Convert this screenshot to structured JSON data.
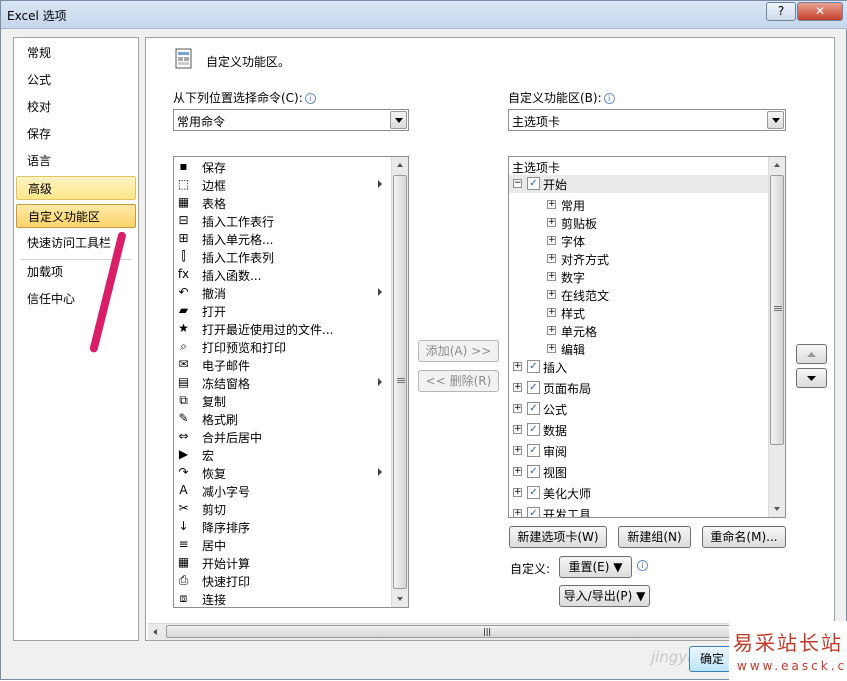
{
  "window": {
    "title": "Excel 选项",
    "help_label": "?",
    "close_label": "✕"
  },
  "sidebar": {
    "items": [
      {
        "label": "常规"
      },
      {
        "label": "公式"
      },
      {
        "label": "校对"
      },
      {
        "label": "保存"
      },
      {
        "label": "语言"
      },
      {
        "label": "高级"
      },
      {
        "label": "自定义功能区"
      },
      {
        "label": "快速访问工具栏"
      },
      {
        "label": "加载项"
      },
      {
        "label": "信任中心"
      }
    ],
    "selected": "自定义功能区"
  },
  "main": {
    "title": "自定义功能区。",
    "choose_from_label": "从下列位置选择命令(C):",
    "choose_from_value": "常用命令",
    "customize_label": "自定义功能区(B):",
    "customize_value": "主选项卡",
    "info_glyph": "i"
  },
  "commands": [
    {
      "label": "保存",
      "icon": "save-icon",
      "glyph": "▪",
      "submenu": false
    },
    {
      "label": "边框",
      "icon": "border-icon",
      "glyph": "⬚",
      "submenu": true
    },
    {
      "label": "表格",
      "icon": "table-icon",
      "glyph": "▦",
      "submenu": false
    },
    {
      "label": "插入工作表行",
      "icon": "insert-row-icon",
      "glyph": "⊟",
      "submenu": false
    },
    {
      "label": "插入单元格...",
      "icon": "insert-cell-icon",
      "glyph": "⊞",
      "submenu": false
    },
    {
      "label": "插入工作表列",
      "icon": "insert-column-icon",
      "glyph": "⫿",
      "submenu": false
    },
    {
      "label": "插入函数...",
      "icon": "function-icon",
      "glyph": "fx",
      "submenu": false
    },
    {
      "label": "撤消",
      "icon": "undo-icon",
      "glyph": "↶",
      "submenu": true
    },
    {
      "label": "打开",
      "icon": "open-folder-icon",
      "glyph": "▰",
      "submenu": false
    },
    {
      "label": "打开最近使用过的文件...",
      "icon": "recent-file-icon",
      "glyph": "★",
      "submenu": false
    },
    {
      "label": "打印预览和打印",
      "icon": "print-preview-icon",
      "glyph": "⌕",
      "submenu": false
    },
    {
      "label": "电子邮件",
      "icon": "email-icon",
      "glyph": "✉",
      "submenu": false
    },
    {
      "label": "冻结窗格",
      "icon": "freeze-panes-icon",
      "glyph": "▤",
      "submenu": true
    },
    {
      "label": "复制",
      "icon": "copy-icon",
      "glyph": "⧉",
      "submenu": false
    },
    {
      "label": "格式刷",
      "icon": "format-painter-icon",
      "glyph": "✎",
      "submenu": false
    },
    {
      "label": "合并后居中",
      "icon": "merge-center-icon",
      "glyph": "⇔",
      "submenu": false
    },
    {
      "label": "宏",
      "icon": "macro-icon",
      "glyph": "▶",
      "submenu": false
    },
    {
      "label": "恢复",
      "icon": "redo-icon",
      "glyph": "↷",
      "submenu": true
    },
    {
      "label": "减小字号",
      "icon": "decrease-font-icon",
      "glyph": "A",
      "submenu": false
    },
    {
      "label": "剪切",
      "icon": "cut-icon",
      "glyph": "✂",
      "submenu": false
    },
    {
      "label": "降序排序",
      "icon": "sort-desc-icon",
      "glyph": "↓",
      "submenu": false
    },
    {
      "label": "居中",
      "icon": "align-center-icon",
      "glyph": "≡",
      "submenu": false
    },
    {
      "label": "开始计算",
      "icon": "calculate-icon",
      "glyph": "▦",
      "submenu": false
    },
    {
      "label": "快速打印",
      "icon": "quick-print-icon",
      "glyph": "⎙",
      "submenu": false
    },
    {
      "label": "连接",
      "icon": "connections-icon",
      "glyph": "⧈",
      "submenu": false
    }
  ],
  "actions": {
    "add_label": "添加(A) >>",
    "remove_label": "<< 删除(R)"
  },
  "ribbon_tree": {
    "header": "主选项卡",
    "tabs": [
      {
        "label": "开始",
        "expanded": true,
        "checked": true,
        "groups": [
          {
            "label": "常用"
          },
          {
            "label": "剪贴板"
          },
          {
            "label": "字体"
          },
          {
            "label": "对齐方式"
          },
          {
            "label": "数字"
          },
          {
            "label": "在线范文"
          },
          {
            "label": "样式"
          },
          {
            "label": "单元格"
          },
          {
            "label": "编辑"
          }
        ]
      },
      {
        "label": "插入",
        "expanded": false,
        "checked": true
      },
      {
        "label": "页面布局",
        "expanded": false,
        "checked": true
      },
      {
        "label": "公式",
        "expanded": false,
        "checked": true
      },
      {
        "label": "数据",
        "expanded": false,
        "checked": true
      },
      {
        "label": "审阅",
        "expanded": false,
        "checked": true
      },
      {
        "label": "视图",
        "expanded": false,
        "checked": true
      },
      {
        "label": "美化大师",
        "expanded": false,
        "checked": true
      },
      {
        "label": "开发工具",
        "expanded": false,
        "checked": true
      }
    ],
    "expand_glyph": "+",
    "collapse_glyph": "−",
    "check_glyph": "✓"
  },
  "tree_buttons": {
    "new_tab_label": "新建选项卡(W)",
    "new_group_label": "新建组(N)",
    "rename_label": "重命名(M)...",
    "customize_label": "自定义:",
    "reset_label": "重置(E) ▼",
    "import_export_label": "导入/导出(P) ▼"
  },
  "footer": {
    "ok_label": "确定",
    "watermark_faint": "jingyan",
    "watermark_title": "易采站长站",
    "watermark_url": "www.easck.com"
  }
}
